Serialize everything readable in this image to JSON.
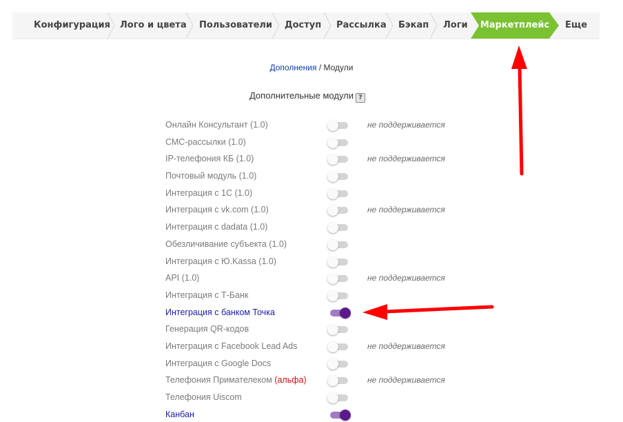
{
  "tabs": [
    {
      "label": "Конфигурация"
    },
    {
      "label": "Лого и цвета"
    },
    {
      "label": "Пользователи"
    },
    {
      "label": "Доступ"
    },
    {
      "label": "Рассылка"
    },
    {
      "label": "Бэкап"
    },
    {
      "label": "Логи"
    },
    {
      "label": "Маркетплейс",
      "active": true
    },
    {
      "label": "Еще"
    }
  ],
  "colors": {
    "active_tab": "#7ac231",
    "toggle_on_knob": "#5a1a8c",
    "toggle_on_track": "#a27bc4",
    "arrow": "#ff0000",
    "link": "#0a3ea6"
  },
  "breadcrumb": {
    "link": "Дополнения",
    "separator": " / ",
    "current": "Модули"
  },
  "section": {
    "title": "Дополнительные модули",
    "help": "?"
  },
  "modules": [
    {
      "name": "Онлайн Консультант (1.0)",
      "enabled": false,
      "status": "не поддерживается"
    },
    {
      "name": "СМС-рассылки (1.0)",
      "enabled": false,
      "status": ""
    },
    {
      "name": "IP-телефония КБ (1.0)",
      "enabled": false,
      "status": "не поддерживается"
    },
    {
      "name": "Почтовый модуль (1.0)",
      "enabled": false,
      "status": ""
    },
    {
      "name": "Интеграция с 1С (1.0)",
      "enabled": false,
      "status": ""
    },
    {
      "name": "Интеграция с vk.com (1.0)",
      "enabled": false,
      "status": "не поддерживается"
    },
    {
      "name": "Интеграция с dadata (1.0)",
      "enabled": false,
      "status": ""
    },
    {
      "name": "Обезличивание субъекта (1.0)",
      "enabled": false,
      "status": ""
    },
    {
      "name": "Интеграция с Ю.Kassa (1.0)",
      "enabled": false,
      "status": ""
    },
    {
      "name": "API (1.0)",
      "enabled": false,
      "status": "не поддерживается"
    },
    {
      "name": "Интеграция с Т-Банк",
      "enabled": false,
      "status": ""
    },
    {
      "name": "Интеграция с банком Точка",
      "enabled": true,
      "status": ""
    },
    {
      "name": "Генерация QR-кодов",
      "enabled": false,
      "status": ""
    },
    {
      "name": "Интеграция с Facebook Lead Ads",
      "enabled": false,
      "status": "не поддерживается"
    },
    {
      "name": "Интеграция с Google Docs",
      "enabled": false,
      "status": ""
    },
    {
      "name": "Телефония Примателеком",
      "tag": "(альфа)",
      "enabled": false,
      "status": "не поддерживается"
    },
    {
      "name": "Телефония Uiscom",
      "enabled": false,
      "status": ""
    },
    {
      "name": "Канбан",
      "enabled": true,
      "status": ""
    }
  ]
}
